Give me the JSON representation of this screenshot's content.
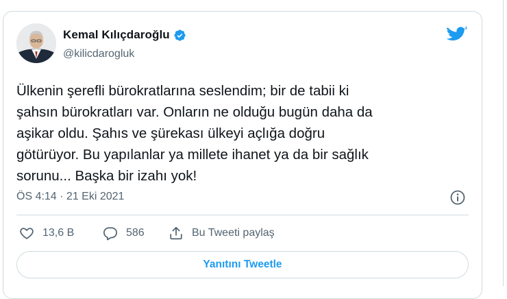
{
  "user": {
    "display_name": "Kemal Kılıçdaroğlu",
    "handle": "@kilicdarogluk",
    "verified": true,
    "avatar_icon": "profile-photo"
  },
  "tweet": {
    "text": "Ülkenin şerefli bürokratlarına seslendim; bir de tabii ki\nşahsın bürokratları var. Onların ne olduğu bugün daha da\naşikar oldu. Şahıs ve şürekası ülkeyi açlığa doğru\ngötürüyor. Bu yapılanlar ya millete ihanet ya da bir sağlık\nsorunu... Başka bir izahı yok!",
    "timestamp": "ÖS 4:14 · 21 Eki 2021"
  },
  "actions": {
    "like_count": "13,6 B",
    "reply_count": "586",
    "share_label": "Bu Tweeti paylaş"
  },
  "reply_button_label": "Yanıtını Tweetle",
  "colors": {
    "accent": "#1d9bf0",
    "text": "#0f1419",
    "secondary": "#536471",
    "border": "#cfd9de"
  },
  "icons": [
    "verified-badge-icon",
    "twitter-bird-icon",
    "info-icon",
    "heart-icon",
    "reply-bubble-icon",
    "share-icon"
  ]
}
